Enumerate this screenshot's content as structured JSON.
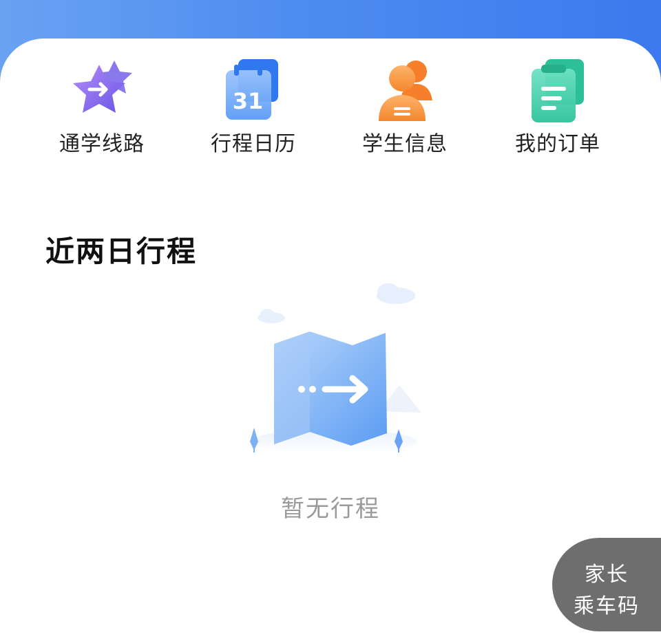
{
  "header": {
    "accent": "#4d8cf0"
  },
  "quick_actions": [
    {
      "label": "通学线路",
      "icon": "star-arrow-icon",
      "color": "#8a6df0"
    },
    {
      "label": "行程日历",
      "icon": "calendar-icon",
      "day": "31",
      "color": "#3f86f2"
    },
    {
      "label": "学生信息",
      "icon": "student-profile-icon",
      "color": "#f79a3e"
    },
    {
      "label": "我的订单",
      "icon": "order-clipboard-icon",
      "color": "#33c9a6"
    }
  ],
  "section": {
    "title": "近两日行程"
  },
  "empty_state": {
    "text": "暂无行程",
    "icon": "map-route-icon"
  },
  "float_button": {
    "line1": "家长",
    "line2": "乘车码"
  }
}
